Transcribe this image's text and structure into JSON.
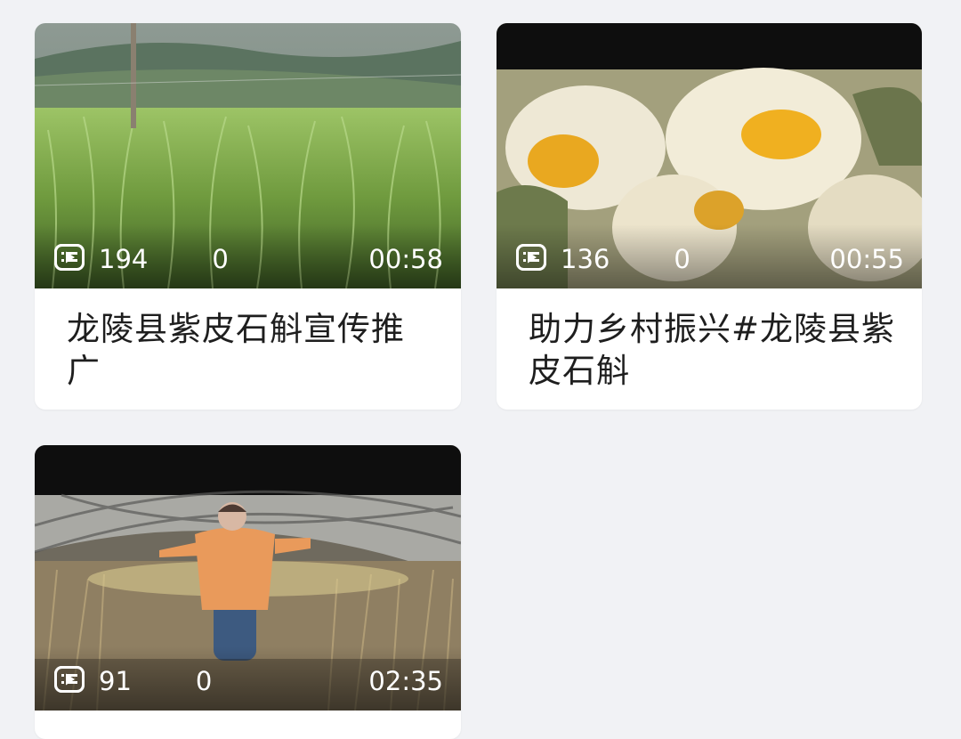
{
  "videos": [
    {
      "title": "龙陵县紫皮石斛宣传推广",
      "plays": "194",
      "comments": "0",
      "duration": "00:58",
      "thumbnail": "field-of-dendrobium-plants"
    },
    {
      "title": "助力乡村振兴#龙陵县紫皮石斛",
      "plays": "136",
      "comments": "0",
      "duration": "00:55",
      "thumbnail": "dendrobium-flowers-closeup"
    },
    {
      "title": "",
      "plays": "91",
      "comments": "0",
      "duration": "02:35",
      "thumbnail": "person-in-greenhouse"
    }
  ],
  "icons": {
    "plays": "play-count-icon",
    "comments": "comment-list-icon"
  },
  "colors": {
    "background": "#f1f2f5",
    "card": "#ffffff",
    "title_text": "#1e1e1e",
    "overlay_text": "#ffffff"
  }
}
